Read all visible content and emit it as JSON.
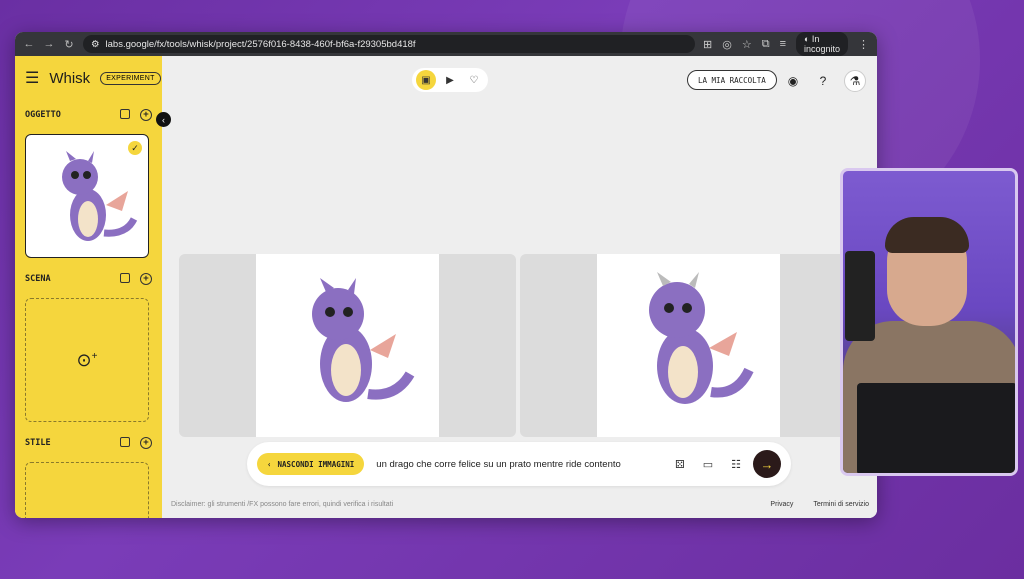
{
  "browser": {
    "url": "labs.google/fx/tools/whisk/project/2576f016-8438-460f-bf6a-f29305bd418f",
    "incognito_label": "In incognito"
  },
  "app": {
    "brand": "Whisk",
    "badge": "EXPERIMENT",
    "sections": {
      "object": "OGGETTO",
      "scene": "SCENA",
      "style": "STILE"
    },
    "collection_button": "LA MIA RACCOLTA",
    "hide_images_button": "NASCONDI IMMAGINI",
    "prompt": "un drago che corre felice su un prato mentre ride contento",
    "disclaimer": "Disclaimer: gli strumenti /FX possono fare errori, quindi verifica i risultati",
    "privacy": "Privacy",
    "terms": "Termini di servizio"
  },
  "colors": {
    "sidebar": "#f5d63d",
    "accent": "#f5d63d",
    "background": "#7a3cb8"
  }
}
